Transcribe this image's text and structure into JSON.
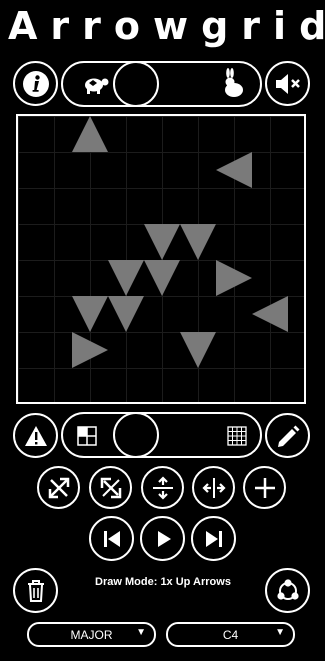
{
  "app": {
    "title": "Arrowgrid"
  },
  "controls": {
    "info_icon": "info-icon",
    "tempo_slow_icon": "turtle-icon",
    "tempo_fast_icon": "rabbit-icon",
    "mute_icon": "speaker-muted-icon",
    "tempo_value": 0.5,
    "size_value": 0.5
  },
  "grid": {
    "arrows": [
      {
        "dir": "up",
        "col": 1,
        "row": 0
      },
      {
        "dir": "left",
        "col": 5,
        "row": 1
      },
      {
        "dir": "down",
        "col": 3,
        "row": 3
      },
      {
        "dir": "down",
        "col": 4,
        "row": 3
      },
      {
        "dir": "down",
        "col": 2,
        "row": 4
      },
      {
        "dir": "down",
        "col": 3,
        "row": 4
      },
      {
        "dir": "right",
        "col": 5,
        "row": 4
      },
      {
        "dir": "down",
        "col": 1,
        "row": 5
      },
      {
        "dir": "down",
        "col": 2,
        "row": 5
      },
      {
        "dir": "left",
        "col": 6,
        "row": 5
      },
      {
        "dir": "right",
        "col": 1,
        "row": 6
      },
      {
        "dir": "down",
        "col": 4,
        "row": 6
      }
    ]
  },
  "status": {
    "text": "Draw Mode: 1x Up Arrows"
  },
  "selects": {
    "scale": "MAJOR",
    "root": "C4"
  }
}
